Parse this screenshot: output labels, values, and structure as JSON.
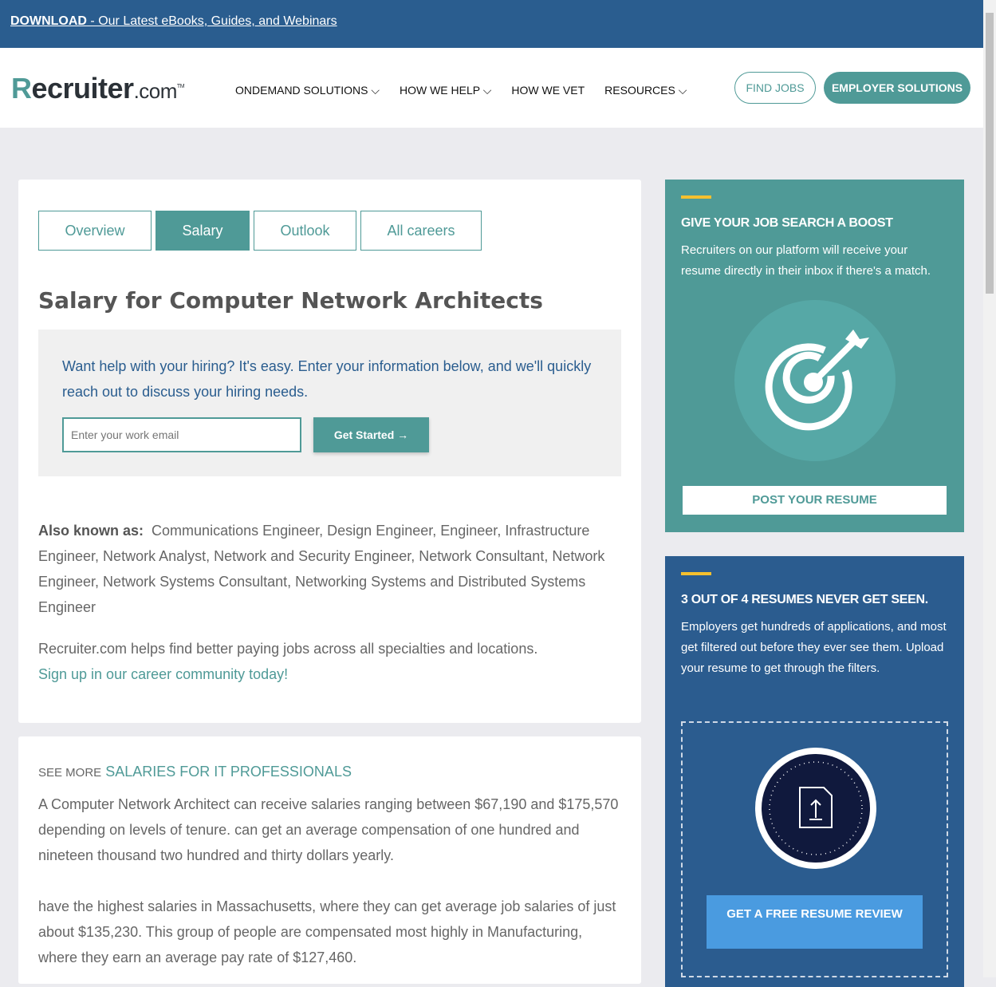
{
  "topbar": {
    "download": "DOWNLOAD",
    "text": " - Our Latest eBooks, Guides, and Webinars"
  },
  "header": {
    "logo": "Recruiter.com",
    "nav": [
      "ONDEMAND SOLUTIONS",
      "HOW WE HELP",
      "HOW WE VET",
      "RESOURCES"
    ],
    "find_jobs": "FIND JOBS",
    "employer": "EMPLOYER SOLUTIONS"
  },
  "tabs": [
    "Overview",
    "Salary",
    "Outlook",
    "All careers"
  ],
  "title": "Salary for Computer Network Architects",
  "hire": {
    "text": "Want help with your hiring? It's easy. Enter your information below, and we'll quickly reach out to discuss your hiring needs.",
    "placeholder": "Enter your work email",
    "button": "Get Started"
  },
  "aka": {
    "label": "Also known as:",
    "text": "Communications Engineer, Design Engineer, Engineer, Infrastructure Engineer, Network Analyst, Network and Security Engineer, Network Consultant, Network Engineer, Network Systems Consultant, Networking Systems and Distributed Systems Engineer"
  },
  "help": {
    "text": "Recruiter.com helps find better paying jobs across all specialties and locations.",
    "link": "Sign up in our career community today!"
  },
  "salaries": {
    "see_more": "SEE MORE",
    "heading": "SALARIES FOR IT PROFESSIONALS",
    "p1": "A Computer Network Architect can receive salaries ranging between $67,190 and $175,570 depending on levels of tenure. can get an average compensation of one hundred and nineteen thousand two hundred and thirty dollars yearly.",
    "p2": "have the highest salaries in Massachusetts, where they can get average job salaries of just about $135,230. This group of people are compensated most highly in Manufacturing, where they earn an average pay rate of $127,460."
  },
  "boost": {
    "title": "GIVE YOUR JOB SEARCH A BOOST",
    "text": "Recruiters on our platform will receive your resume directly in their inbox if there's a match.",
    "button": "POST YOUR RESUME"
  },
  "resumes": {
    "title": "3 OUT OF 4 RESUMES NEVER GET SEEN.",
    "text": "Employers get hundreds of applications, and most get filtered out before they ever see them. Upload your resume to get through the filters.",
    "button": "GET A FREE RESUME REVIEW"
  }
}
